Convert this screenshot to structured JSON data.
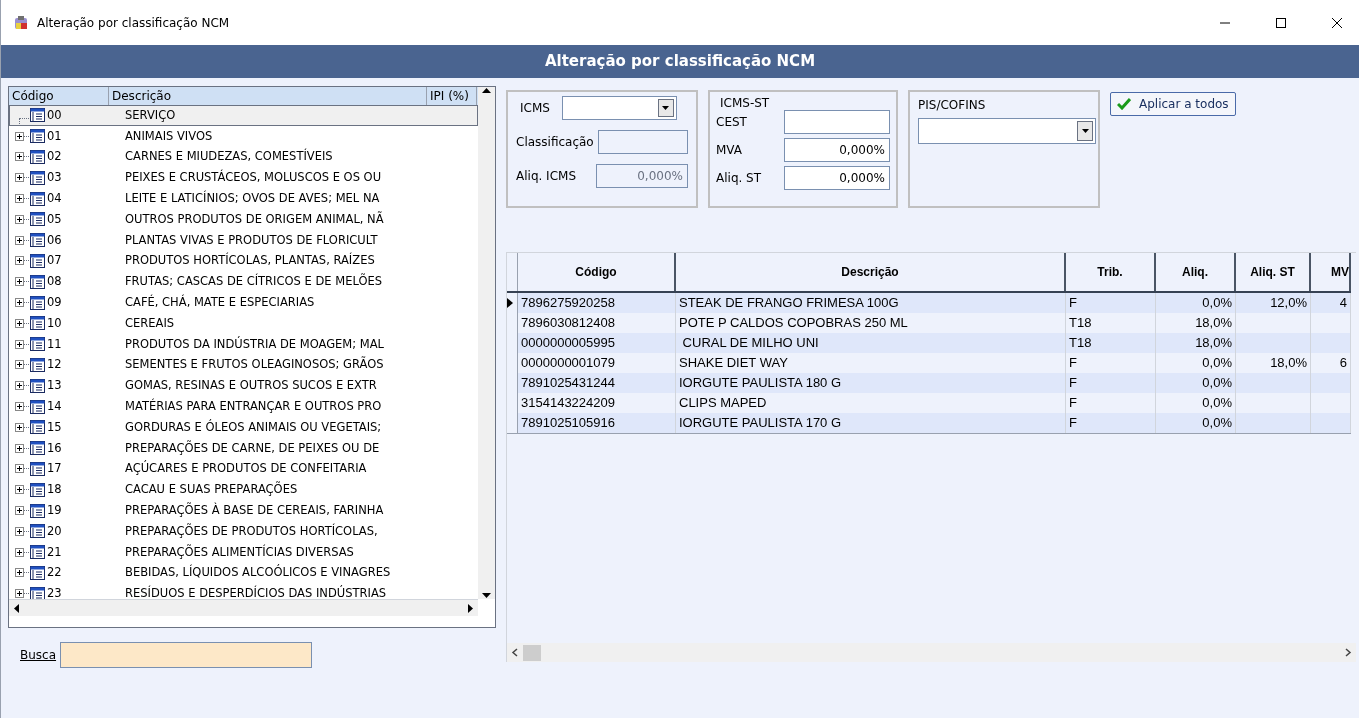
{
  "window": {
    "title": "Alteração por classificação NCM"
  },
  "header": {
    "title": "Alteração por classificação NCM"
  },
  "tree": {
    "columns": [
      "Código",
      "Descrição",
      "IPI (%)"
    ],
    "items": [
      {
        "code": "00",
        "description": "SERVIÇO",
        "expandable": false,
        "selected": true
      },
      {
        "code": "01",
        "description": "ANIMAIS VIVOS",
        "expandable": true,
        "selected": false
      },
      {
        "code": "02",
        "description": "CARNES E MIUDEZAS, COMESTÍVEIS",
        "expandable": true,
        "selected": false
      },
      {
        "code": "03",
        "description": "PEIXES E CRUSTÁCEOS, MOLUSCOS E OS OU",
        "expandable": true,
        "selected": false
      },
      {
        "code": "04",
        "description": "LEITE E LATICÍNIOS; OVOS DE AVES; MEL NA",
        "expandable": true,
        "selected": false
      },
      {
        "code": "05",
        "description": "OUTROS PRODUTOS DE ORIGEM ANIMAL, NÃ",
        "expandable": true,
        "selected": false
      },
      {
        "code": "06",
        "description": "PLANTAS VIVAS E PRODUTOS DE FLORICULT",
        "expandable": true,
        "selected": false
      },
      {
        "code": "07",
        "description": "PRODUTOS HORTÍCOLAS, PLANTAS, RAÍZES",
        "expandable": true,
        "selected": false
      },
      {
        "code": "08",
        "description": "FRUTAS; CASCAS DE CÍTRICOS E DE MELÕES",
        "expandable": true,
        "selected": false
      },
      {
        "code": "09",
        "description": "CAFÉ, CHÁ, MATE E ESPECIARIAS",
        "expandable": true,
        "selected": false
      },
      {
        "code": "10",
        "description": "CEREAIS",
        "expandable": true,
        "selected": false
      },
      {
        "code": "11",
        "description": "PRODUTOS DA INDÚSTRIA DE MOAGEM; MAL",
        "expandable": true,
        "selected": false
      },
      {
        "code": "12",
        "description": "SEMENTES E FRUTOS OLEAGINOSOS; GRÃOS",
        "expandable": true,
        "selected": false
      },
      {
        "code": "13",
        "description": "GOMAS, RESINAS E OUTROS SUCOS E EXTR",
        "expandable": true,
        "selected": false
      },
      {
        "code": "14",
        "description": "MATÉRIAS PARA ENTRANÇAR E OUTROS PRO",
        "expandable": true,
        "selected": false
      },
      {
        "code": "15",
        "description": "GORDURAS E ÓLEOS ANIMAIS OU VEGETAIS;",
        "expandable": true,
        "selected": false
      },
      {
        "code": "16",
        "description": "PREPARAÇÕES DE CARNE, DE PEIXES OU DE",
        "expandable": true,
        "selected": false
      },
      {
        "code": "17",
        "description": "AÇÚCARES E PRODUTOS DE CONFEITARIA",
        "expandable": true,
        "selected": false
      },
      {
        "code": "18",
        "description": "CACAU E SUAS PREPARAÇÕES",
        "expandable": true,
        "selected": false
      },
      {
        "code": "19",
        "description": "PREPARAÇÕES À BASE DE CEREAIS, FARINHA",
        "expandable": true,
        "selected": false
      },
      {
        "code": "20",
        "description": "PREPARAÇÕES DE PRODUTOS HORTÍCOLAS,",
        "expandable": true,
        "selected": false
      },
      {
        "code": "21",
        "description": "PREPARAÇÕES ALIMENTÍCIAS DIVERSAS",
        "expandable": true,
        "selected": false
      },
      {
        "code": "22",
        "description": "BEBIDAS, LÍQUIDOS ALCOÓLICOS E VINAGRES",
        "expandable": true,
        "selected": false
      },
      {
        "code": "23",
        "description": "RESÍDUOS E DESPERDÍCIOS DAS INDÚSTRIAS",
        "expandable": true,
        "selected": false
      }
    ]
  },
  "search": {
    "label": "Busca"
  },
  "icms": {
    "label": "ICMS",
    "classificacao_label": "Classificação",
    "aliq_label": "Aliq. ICMS",
    "aliq_value": "0,000%"
  },
  "icms_st": {
    "title": "ICMS-ST",
    "cest_label": "CEST",
    "mva_label": "MVA",
    "mva_value": "0,000%",
    "aliq_st_label": "Aliq. ST",
    "aliq_st_value": "0,000%"
  },
  "pis_cofins": {
    "title": "PIS/COFINS"
  },
  "apply_button": {
    "label": "Aplicar a todos"
  },
  "table": {
    "columns": [
      "Código",
      "Descrição",
      "Trib.",
      "Aliq.",
      "Aliq. ST",
      "MV"
    ],
    "rows": [
      {
        "selected": true,
        "cells": [
          "7896275920258",
          "STEAK DE FRANGO FRIMESA 100G",
          "F",
          "0,0%",
          "12,0%",
          "4"
        ]
      },
      {
        "selected": false,
        "cells": [
          "7896030812408",
          "POTE P CALDOS COPOBRAS 250 ML",
          "T18",
          "18,0%",
          "",
          ""
        ]
      },
      {
        "selected": false,
        "cells": [
          "0000000005995",
          " CURAL DE MILHO UNI",
          "T18",
          "18,0%",
          "",
          ""
        ]
      },
      {
        "selected": false,
        "cells": [
          "0000000001079",
          "SHAKE DIET WAY",
          "F",
          "0,0%",
          "18,0%",
          "6"
        ]
      },
      {
        "selected": false,
        "cells": [
          "7891025431244",
          "IORGUTE PAULISTA 180 G",
          "F",
          "0,0%",
          "",
          ""
        ]
      },
      {
        "selected": false,
        "cells": [
          "3154143224209",
          "CLIPS MAPED",
          "F",
          "0,0%",
          "",
          ""
        ]
      },
      {
        "selected": false,
        "cells": [
          "7891025105916",
          "IORGUTE PAULISTA 170 G",
          "F",
          "0,0%",
          "",
          ""
        ]
      }
    ]
  }
}
